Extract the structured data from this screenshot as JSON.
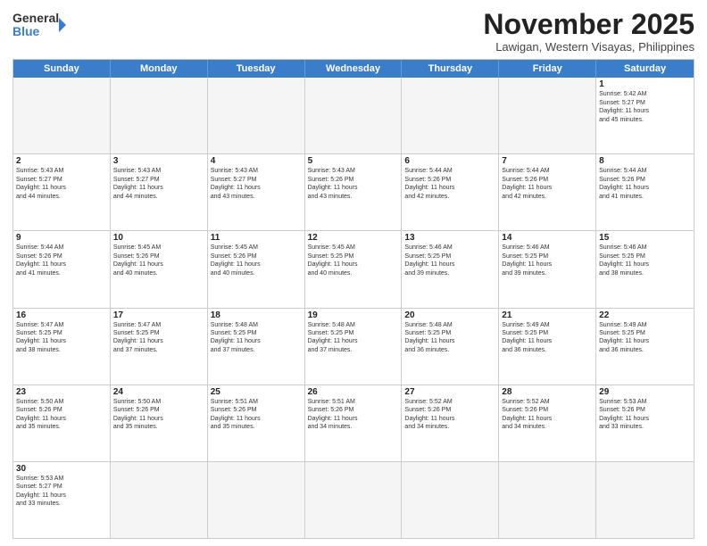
{
  "header": {
    "logo_line1": "General",
    "logo_line2": "Blue",
    "month_title": "November 2025",
    "location": "Lawigan, Western Visayas, Philippines"
  },
  "days_of_week": [
    "Sunday",
    "Monday",
    "Tuesday",
    "Wednesday",
    "Thursday",
    "Friday",
    "Saturday"
  ],
  "weeks": [
    [
      {
        "day": "",
        "empty": true
      },
      {
        "day": "",
        "empty": true
      },
      {
        "day": "",
        "empty": true
      },
      {
        "day": "",
        "empty": true
      },
      {
        "day": "",
        "empty": true
      },
      {
        "day": "",
        "empty": true
      },
      {
        "day": "1",
        "sunrise": "5:42 AM",
        "sunset": "5:27 PM",
        "hours": "11 hours",
        "minutes": "45 minutes"
      }
    ],
    [
      {
        "day": "2",
        "sunrise": "5:43 AM",
        "sunset": "5:27 PM",
        "hours": "11 hours",
        "minutes": "44 minutes"
      },
      {
        "day": "3",
        "sunrise": "5:43 AM",
        "sunset": "5:27 PM",
        "hours": "11 hours",
        "minutes": "44 minutes"
      },
      {
        "day": "4",
        "sunrise": "5:43 AM",
        "sunset": "5:27 PM",
        "hours": "11 hours",
        "minutes": "43 minutes"
      },
      {
        "day": "5",
        "sunrise": "5:43 AM",
        "sunset": "5:26 PM",
        "hours": "11 hours",
        "minutes": "43 minutes"
      },
      {
        "day": "6",
        "sunrise": "5:44 AM",
        "sunset": "5:26 PM",
        "hours": "11 hours",
        "minutes": "42 minutes"
      },
      {
        "day": "7",
        "sunrise": "5:44 AM",
        "sunset": "5:26 PM",
        "hours": "11 hours",
        "minutes": "42 minutes"
      },
      {
        "day": "8",
        "sunrise": "5:44 AM",
        "sunset": "5:26 PM",
        "hours": "11 hours",
        "minutes": "41 minutes"
      }
    ],
    [
      {
        "day": "9",
        "sunrise": "5:44 AM",
        "sunset": "5:26 PM",
        "hours": "11 hours",
        "minutes": "41 minutes"
      },
      {
        "day": "10",
        "sunrise": "5:45 AM",
        "sunset": "5:26 PM",
        "hours": "11 hours",
        "minutes": "40 minutes"
      },
      {
        "day": "11",
        "sunrise": "5:45 AM",
        "sunset": "5:26 PM",
        "hours": "11 hours",
        "minutes": "40 minutes"
      },
      {
        "day": "12",
        "sunrise": "5:45 AM",
        "sunset": "5:25 PM",
        "hours": "11 hours",
        "minutes": "40 minutes"
      },
      {
        "day": "13",
        "sunrise": "5:46 AM",
        "sunset": "5:25 PM",
        "hours": "11 hours",
        "minutes": "39 minutes"
      },
      {
        "day": "14",
        "sunrise": "5:46 AM",
        "sunset": "5:25 PM",
        "hours": "11 hours",
        "minutes": "39 minutes"
      },
      {
        "day": "15",
        "sunrise": "5:46 AM",
        "sunset": "5:25 PM",
        "hours": "11 hours",
        "minutes": "38 minutes"
      }
    ],
    [
      {
        "day": "16",
        "sunrise": "5:47 AM",
        "sunset": "5:25 PM",
        "hours": "11 hours",
        "minutes": "38 minutes"
      },
      {
        "day": "17",
        "sunrise": "5:47 AM",
        "sunset": "5:25 PM",
        "hours": "11 hours",
        "minutes": "37 minutes"
      },
      {
        "day": "18",
        "sunrise": "5:48 AM",
        "sunset": "5:25 PM",
        "hours": "11 hours",
        "minutes": "37 minutes"
      },
      {
        "day": "19",
        "sunrise": "5:48 AM",
        "sunset": "5:25 PM",
        "hours": "11 hours",
        "minutes": "37 minutes"
      },
      {
        "day": "20",
        "sunrise": "5:48 AM",
        "sunset": "5:25 PM",
        "hours": "11 hours",
        "minutes": "36 minutes"
      },
      {
        "day": "21",
        "sunrise": "5:49 AM",
        "sunset": "5:25 PM",
        "hours": "11 hours",
        "minutes": "36 minutes"
      },
      {
        "day": "22",
        "sunrise": "5:49 AM",
        "sunset": "5:25 PM",
        "hours": "11 hours",
        "minutes": "36 minutes"
      }
    ],
    [
      {
        "day": "23",
        "sunrise": "5:50 AM",
        "sunset": "5:26 PM",
        "hours": "11 hours",
        "minutes": "35 minutes"
      },
      {
        "day": "24",
        "sunrise": "5:50 AM",
        "sunset": "5:26 PM",
        "hours": "11 hours",
        "minutes": "35 minutes"
      },
      {
        "day": "25",
        "sunrise": "5:51 AM",
        "sunset": "5:26 PM",
        "hours": "11 hours",
        "minutes": "35 minutes"
      },
      {
        "day": "26",
        "sunrise": "5:51 AM",
        "sunset": "5:26 PM",
        "hours": "11 hours",
        "minutes": "34 minutes"
      },
      {
        "day": "27",
        "sunrise": "5:52 AM",
        "sunset": "5:26 PM",
        "hours": "11 hours",
        "minutes": "34 minutes"
      },
      {
        "day": "28",
        "sunrise": "5:52 AM",
        "sunset": "5:26 PM",
        "hours": "11 hours",
        "minutes": "34 minutes"
      },
      {
        "day": "29",
        "sunrise": "5:53 AM",
        "sunset": "5:26 PM",
        "hours": "11 hours",
        "minutes": "33 minutes"
      }
    ],
    [
      {
        "day": "30",
        "sunrise": "5:53 AM",
        "sunset": "5:27 PM",
        "hours": "11 hours",
        "minutes": "33 minutes"
      },
      {
        "day": "",
        "empty": true
      },
      {
        "day": "",
        "empty": true
      },
      {
        "day": "",
        "empty": true
      },
      {
        "day": "",
        "empty": true
      },
      {
        "day": "",
        "empty": true
      },
      {
        "day": "",
        "empty": true
      }
    ]
  ]
}
